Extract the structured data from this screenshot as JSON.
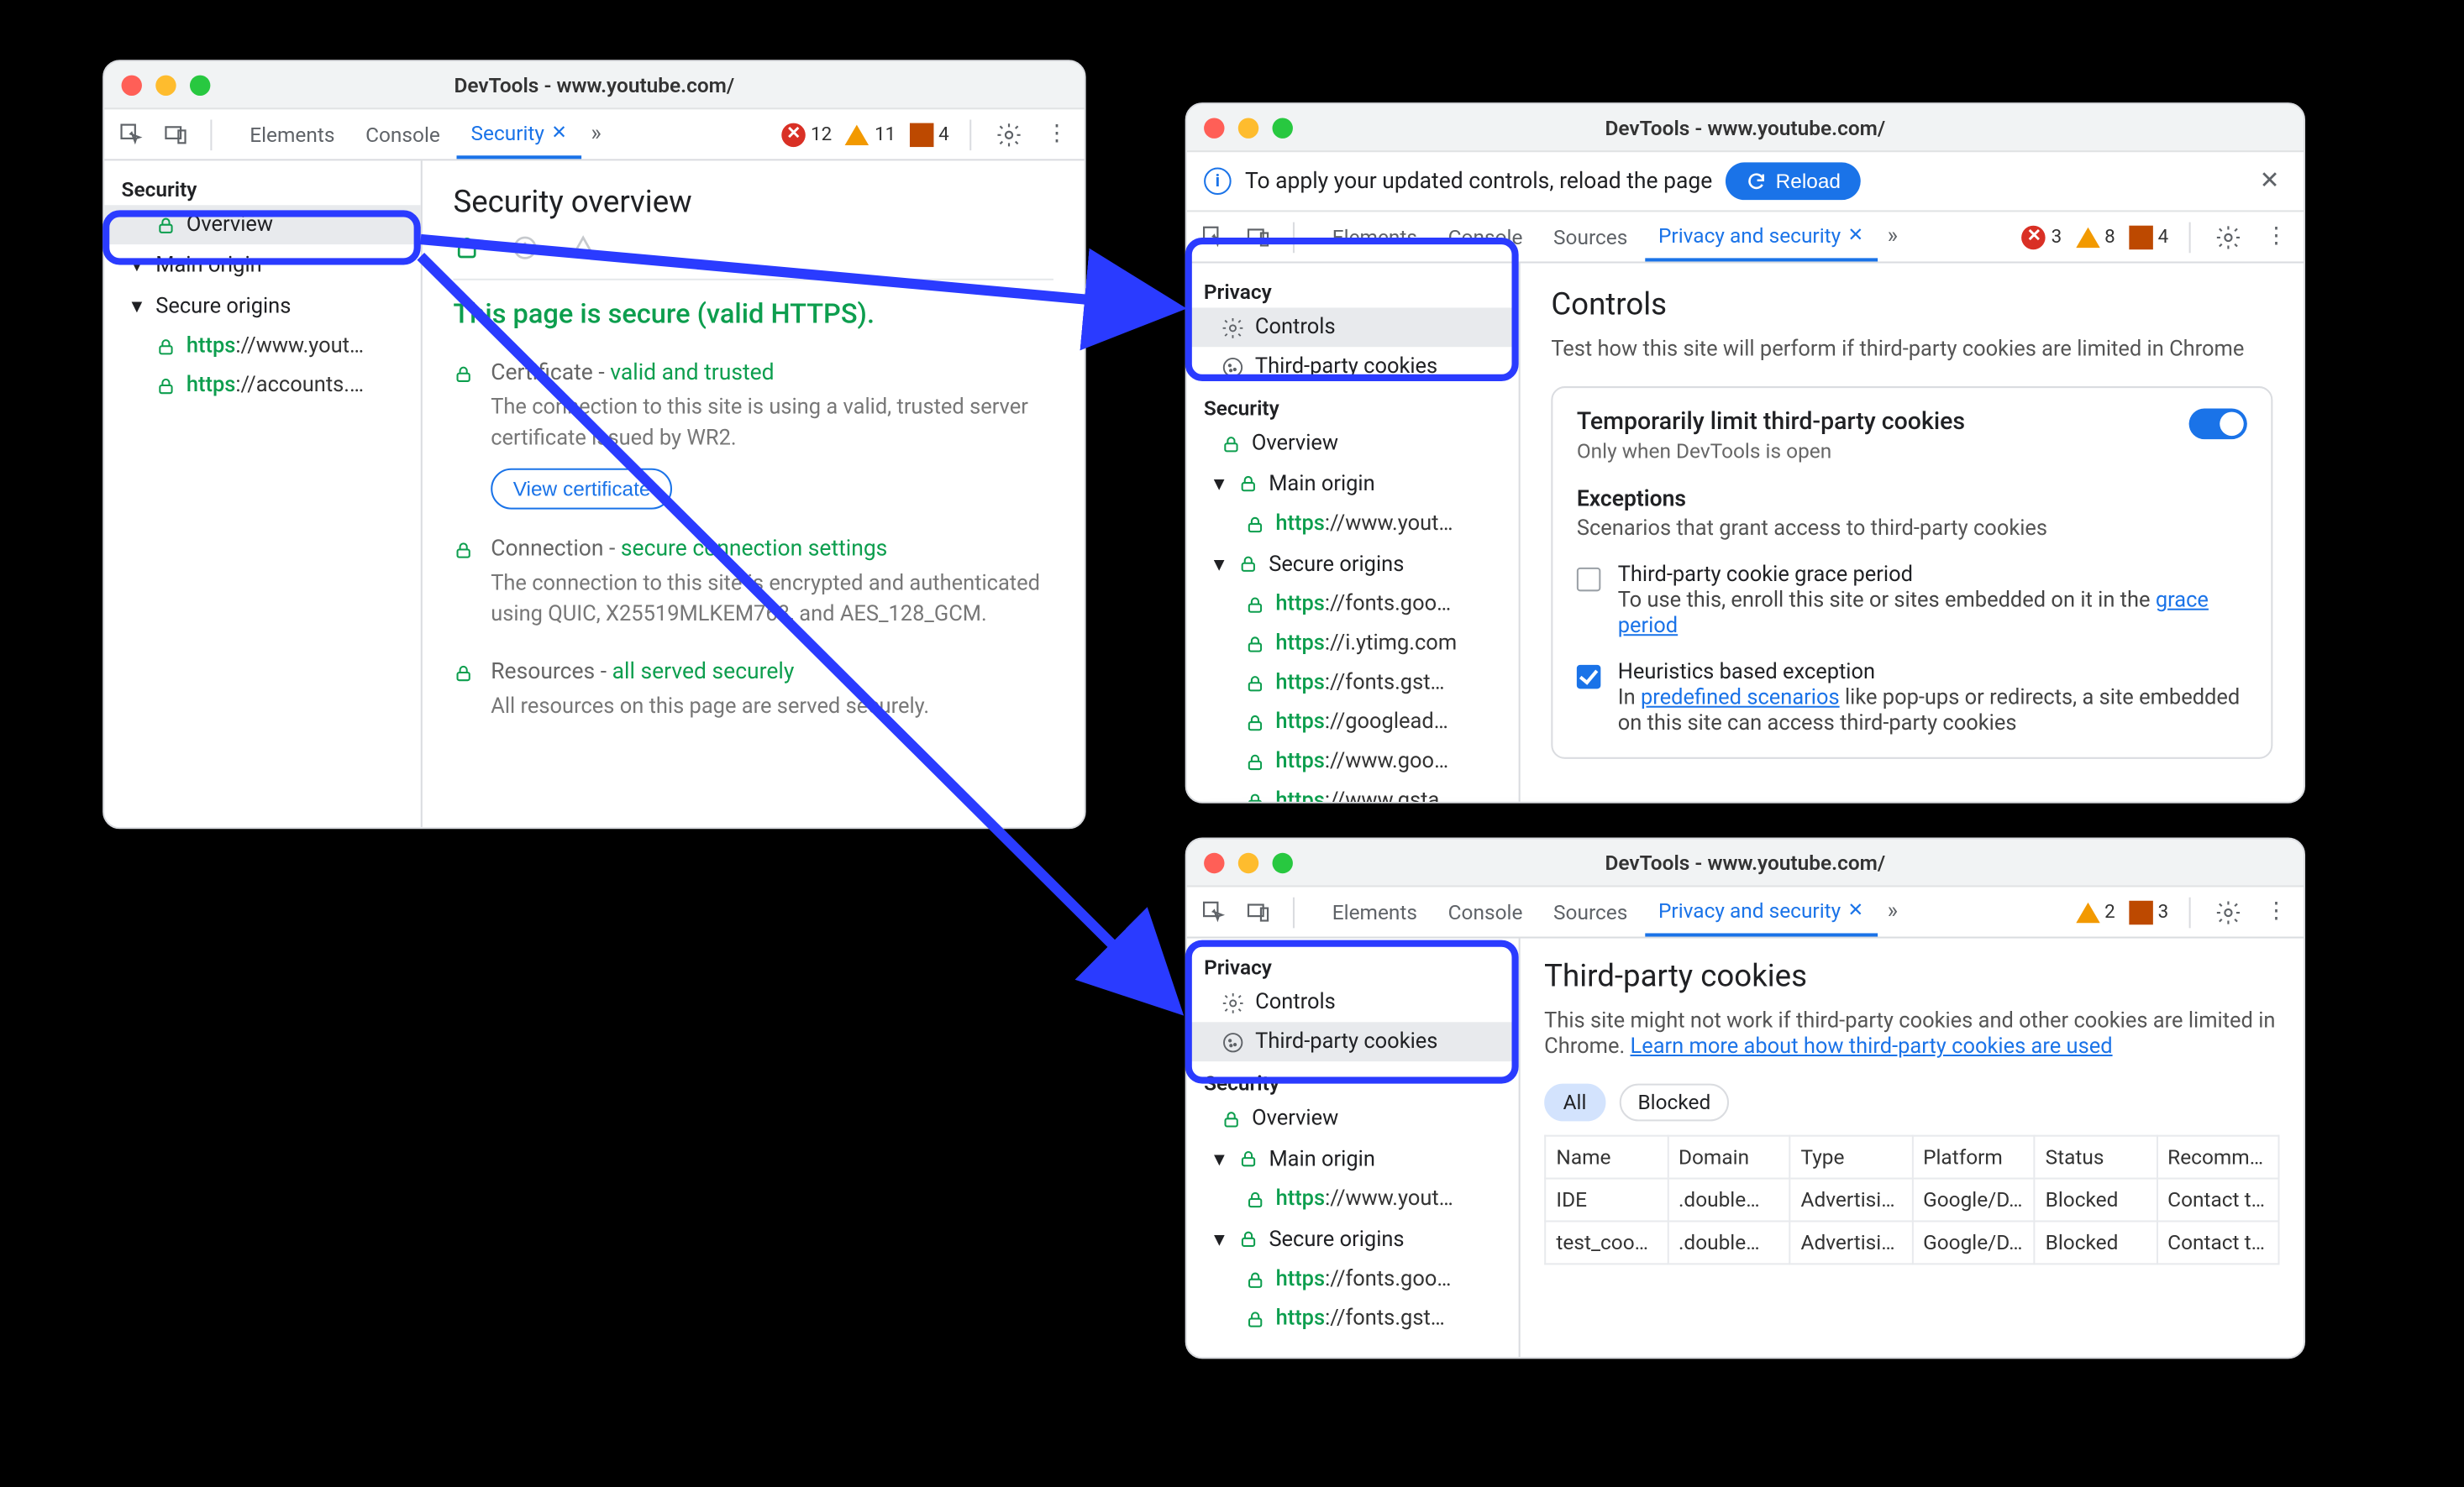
{
  "windows": {
    "w1": {
      "title": "DevTools - www.youtube.com/",
      "tabs": [
        "Elements",
        "Console",
        "Security"
      ],
      "active_tab": "Security",
      "more_tabs_icon": "»",
      "status": {
        "errors": 12,
        "warnings": 11,
        "issues": 4
      },
      "sidebar": {
        "group_security": "Security",
        "overview": "Overview",
        "main_origin": "Main origin",
        "secure_origins": "Secure origins",
        "origins": {
          "o1_scheme": "https",
          "o1_host": "://www.yout…",
          "o2_scheme": "https",
          "o2_host": "://accounts.…"
        }
      },
      "content": {
        "heading": "Security overview",
        "page_secure": "This page is secure (valid HTTPS).",
        "cert_label": "Certificate - ",
        "cert_good": "valid and trusted",
        "cert_desc": "The connection to this site is using a valid, trusted server certificate issued by WR2.",
        "view_cert": "View certificate",
        "conn_label": "Connection - ",
        "conn_good": "secure connection settings",
        "conn_desc": "The connection to this site is encrypted and authenticated using QUIC, X25519MLKEM768, and AES_128_GCM.",
        "res_label": "Resources - ",
        "res_good": "all served securely",
        "res_desc": "All resources on this page are served securely."
      }
    },
    "w2": {
      "title": "DevTools - www.youtube.com/",
      "infobar_text": "To apply your updated controls, reload the page",
      "reload_label": "Reload",
      "tabs": [
        "Elements",
        "Console",
        "Sources",
        "Privacy and security"
      ],
      "active_tab": "Privacy and security",
      "more_tabs_icon": "»",
      "status": {
        "errors": 3,
        "warnings": 8,
        "issues": 4
      },
      "sidebar": {
        "group_privacy": "Privacy",
        "controls": "Controls",
        "tpc": "Third-party cookies",
        "group_security": "Security",
        "overview": "Overview",
        "main_origin": "Main origin",
        "secure_origins": "Secure origins",
        "origins": {
          "m1_scheme": "https",
          "m1_host": "://www.yout…",
          "s1_scheme": "https",
          "s1_host": "://fonts.goo…",
          "s2_scheme": "https",
          "s2_host": "://i.ytimg.com",
          "s3_scheme": "https",
          "s3_host": "://fonts.gst…",
          "s4_scheme": "https",
          "s4_host": "://googlead…",
          "s5_scheme": "https",
          "s5_host": "://www.goo…",
          "s6_scheme": "https",
          "s6_host": "://www.gsta…"
        }
      },
      "content": {
        "heading": "Controls",
        "sub": "Test how this site will perform if third-party cookies are limited in Chrome",
        "limit_title": "Temporarily limit third-party cookies",
        "limit_sub": "Only when DevTools is open",
        "exc_title": "Exceptions",
        "exc_sub": "Scenarios that grant access to third-party cookies",
        "exc1_title": "Third-party cookie grace period",
        "exc1_prefix": "To use this, enroll this site or sites embedded on it in the ",
        "exc1_link": "grace period",
        "exc2_title": "Heuristics based exception",
        "exc2_prefix": "In ",
        "exc2_link": "predefined scenarios",
        "exc2_suffix": " like pop-ups or redirects, a site embedded on this site can access third-party cookies"
      }
    },
    "w3": {
      "title": "DevTools - www.youtube.com/",
      "tabs": [
        "Elements",
        "Console",
        "Sources",
        "Privacy and security"
      ],
      "active_tab": "Privacy and security",
      "more_tabs_icon": "»",
      "status": {
        "warnings": 2,
        "issues": 3
      },
      "sidebar": {
        "group_privacy": "Privacy",
        "controls": "Controls",
        "tpc": "Third-party cookies",
        "group_security": "Security",
        "overview": "Overview",
        "main_origin": "Main origin",
        "secure_origins": "Secure origins",
        "origins": {
          "m1_scheme": "https",
          "m1_host": "://www.yout…",
          "s1_scheme": "https",
          "s1_host": "://fonts.goo…",
          "s2_scheme": "https",
          "s2_host": "://fonts.gst…"
        }
      },
      "content": {
        "heading": "Third-party cookies",
        "sub_prefix": "This site might not work if third-party cookies and other cookies are limited in Chrome. ",
        "sub_link": "Learn more about how third-party cookies are used",
        "pill_all": "All",
        "pill_blocked": "Blocked",
        "columns": [
          "Name",
          "Domain",
          "Type",
          "Platform",
          "Status",
          "Recomm…"
        ],
        "rows": [
          {
            "c0": "IDE",
            "c1": ".double…",
            "c2": "Advertisi…",
            "c3": "Google/D…",
            "c4": "Blocked",
            "c5": "Contact t…"
          },
          {
            "c0": "test_cookie",
            "c1": ".double…",
            "c2": "Advertisi…",
            "c3": "Google/D…",
            "c4": "Blocked",
            "c5": "Contact t…"
          }
        ]
      }
    }
  }
}
